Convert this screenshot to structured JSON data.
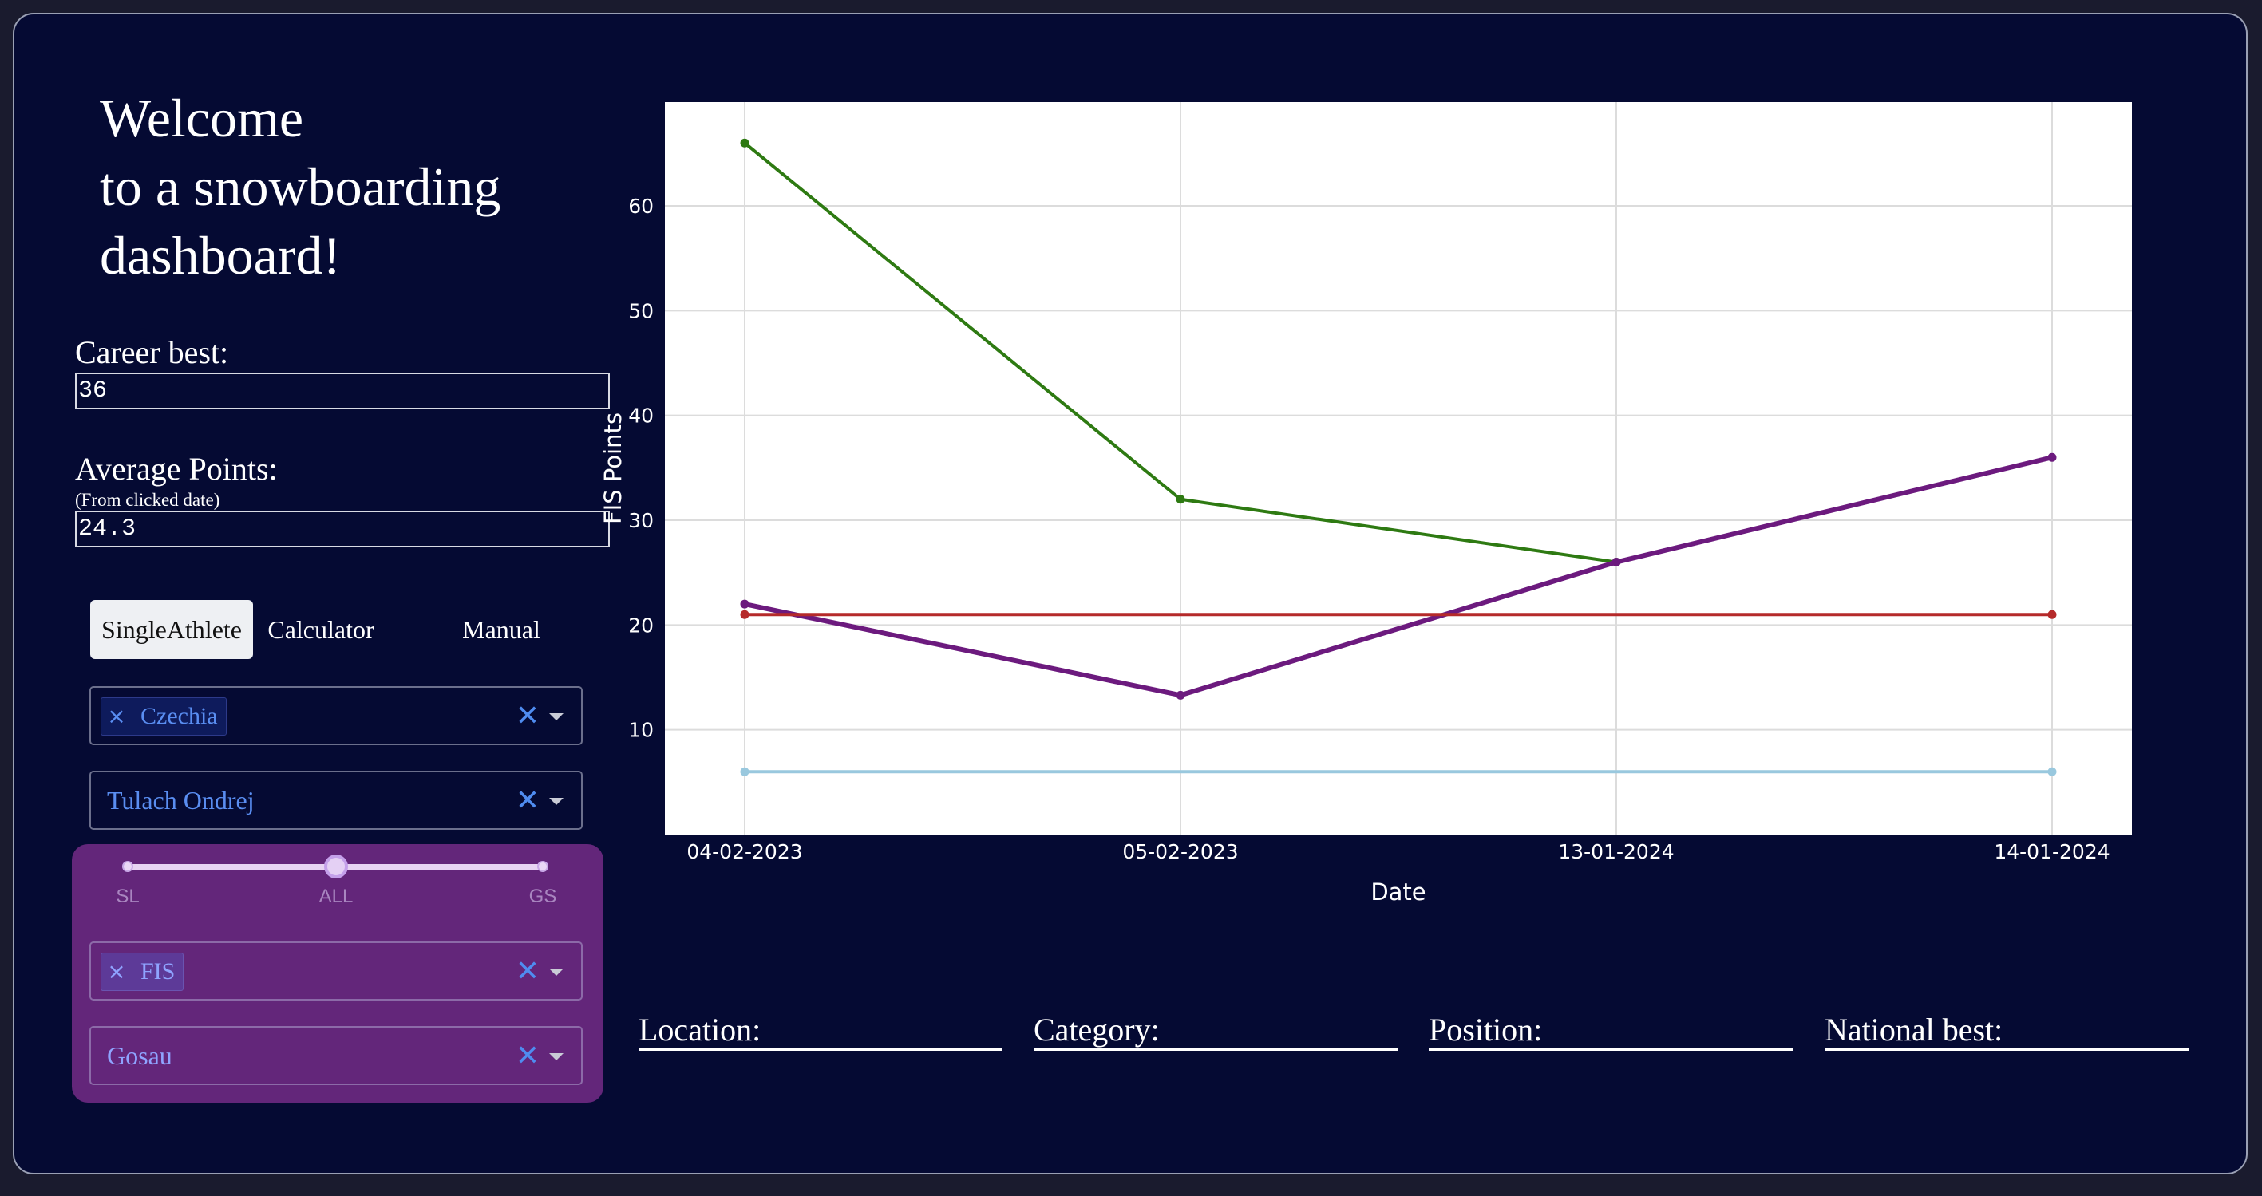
{
  "welcome": {
    "line1": "Welcome",
    "line2": "to a snowboarding",
    "line3": "dashboard!"
  },
  "career_best": {
    "label": "Career best:",
    "value": "36"
  },
  "average_points": {
    "label": "Average Points:",
    "sublabel": "(From clicked date)",
    "value": "24.3"
  },
  "tabs": [
    {
      "label": "SingleAthlete",
      "active": true
    },
    {
      "label": "Calculator",
      "active": false
    },
    {
      "label": "Manual",
      "active": false
    }
  ],
  "country_dropdown": {
    "chip": "Czechia",
    "chip_remove_icon": "close-icon",
    "clear_icon": "close-icon",
    "caret_icon": "chevron-down-icon"
  },
  "athlete_dropdown": {
    "value": "Tulach Ondrej"
  },
  "discipline_slider": {
    "marks": [
      "SL",
      "ALL",
      "GS"
    ],
    "selected": "ALL",
    "selected_fraction": 0.5
  },
  "category_dropdown": {
    "chip": "FIS"
  },
  "location_dropdown": {
    "value": "Gosau"
  },
  "info_fields": [
    {
      "label": "Location:"
    },
    {
      "label": "Category:"
    },
    {
      "label": "Position:"
    },
    {
      "label": "National best:"
    }
  ],
  "colors": {
    "background": "#050a33",
    "panel_purple": "#63267a",
    "accent_blue": "#5a8ef2"
  },
  "chart_data": {
    "type": "line",
    "x": [
      "04-02-2023",
      "05-02-2023",
      "13-01-2024",
      "14-01-2024"
    ],
    "xlabel": "Date",
    "ylabel": "FIS Points",
    "yticks": [
      10,
      20,
      30,
      40,
      50,
      60
    ],
    "ylim": [
      0,
      69.9
    ],
    "grid": true,
    "series": [
      {
        "color": "#2e7a12",
        "values": [
          66,
          32,
          26,
          null
        ]
      },
      {
        "color": "#6c1a7e",
        "values": [
          22,
          13.3,
          26,
          36
        ]
      },
      {
        "color": "#b52a2a",
        "values": [
          21,
          null,
          null,
          21
        ]
      },
      {
        "color": "#99c8de",
        "values": [
          6,
          null,
          null,
          6
        ]
      }
    ]
  }
}
